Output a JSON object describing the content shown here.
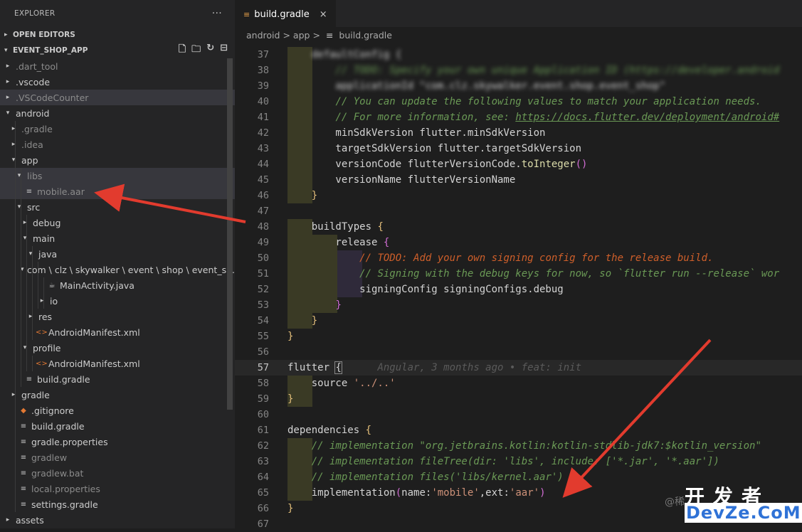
{
  "sidebar": {
    "title": "EXPLORER",
    "more": "···",
    "open_editors": "OPEN EDITORS",
    "project": "EVENT_SHOP_APP",
    "tree": [
      {
        "label": ".dart_tool",
        "depth": 1,
        "chev": "▸",
        "dim": true
      },
      {
        "label": ".vscode",
        "depth": 1,
        "chev": "▸",
        "dim": false
      },
      {
        "label": ".VSCodeCounter",
        "depth": 1,
        "chev": "▸",
        "dim": true,
        "sel": true
      },
      {
        "label": "android",
        "depth": 1,
        "chev": "▾",
        "dim": false
      },
      {
        "label": ".gradle",
        "depth": 2,
        "chev": "▸",
        "dim": true
      },
      {
        "label": ".idea",
        "depth": 2,
        "chev": "▸",
        "dim": true
      },
      {
        "label": "app",
        "depth": 2,
        "chev": "▾",
        "dim": false
      },
      {
        "label": "libs",
        "depth": 3,
        "chev": "▾",
        "dim": true,
        "sel": true
      },
      {
        "label": "mobile.aar",
        "depth": 3,
        "icon": "file-lines-icon",
        "dim": true,
        "sel": true
      },
      {
        "label": "src",
        "depth": 3,
        "chev": "▾",
        "dim": false
      },
      {
        "label": "debug",
        "depth": 4,
        "chev": "▸",
        "dim": false
      },
      {
        "label": "main",
        "depth": 4,
        "chev": "▾",
        "dim": false
      },
      {
        "label": "java",
        "depth": 5,
        "chev": "▾",
        "dim": false
      },
      {
        "label": "com \\ clz \\ skywalker \\ event \\ shop \\ event_s...",
        "depth": 6,
        "chev": "▾",
        "dim": false
      },
      {
        "label": "MainActivity.java",
        "depth": 7,
        "icon": "java-icon",
        "dim": false
      },
      {
        "label": "io",
        "depth": 7,
        "chev": "▸",
        "dim": false
      },
      {
        "label": "res",
        "depth": 5,
        "chev": "▸",
        "dim": false
      },
      {
        "label": "AndroidManifest.xml",
        "depth": 5,
        "icon": "xml-icon",
        "dim": false
      },
      {
        "label": "profile",
        "depth": 4,
        "chev": "▾",
        "dim": false
      },
      {
        "label": "AndroidManifest.xml",
        "depth": 5,
        "icon": "xml-icon",
        "dim": false
      },
      {
        "label": "build.gradle",
        "depth": 3,
        "icon": "file-lines-icon",
        "dim": false
      },
      {
        "label": "gradle",
        "depth": 2,
        "chev": "▸",
        "dim": false
      },
      {
        "label": ".gitignore",
        "depth": 2,
        "icon": "git-icon",
        "dim": false
      },
      {
        "label": "build.gradle",
        "depth": 2,
        "icon": "file-lines-icon",
        "dim": false
      },
      {
        "label": "gradle.properties",
        "depth": 2,
        "icon": "file-lines-icon",
        "dim": false
      },
      {
        "label": "gradlew",
        "depth": 2,
        "icon": "file-lines-icon",
        "dim": true
      },
      {
        "label": "gradlew.bat",
        "depth": 2,
        "icon": "file-lines-icon",
        "dim": true
      },
      {
        "label": "local.properties",
        "depth": 2,
        "icon": "file-lines-icon",
        "dim": true
      },
      {
        "label": "settings.gradle",
        "depth": 2,
        "icon": "file-lines-icon",
        "dim": false
      },
      {
        "label": "assets",
        "depth": 1,
        "chev": "▸",
        "dim": false
      }
    ]
  },
  "editor": {
    "tab_label": "build.gradle",
    "tab_close": "×",
    "breadcrumb": [
      "android",
      "app",
      "build.gradle"
    ],
    "breadcrumb_sep": ">",
    "lines": [
      {
        "n": "37",
        "html": "<span class='blur'>    defaultConfig {</span>"
      },
      {
        "n": "38",
        "html": "<span class='blur cm'>        // TODO: Specify your own unique Application ID (https://developer.android</span>"
      },
      {
        "n": "39",
        "html": "<span class='blur'>        applicationId \"com.clz.skywalker.event.shop.event_shop\"</span>"
      },
      {
        "n": "40",
        "html": "        <span class='cm'>// You can update the following values to match your application needs.</span>"
      },
      {
        "n": "41",
        "html": "        <span class='cm'>// For more information, see: <span class='link'>https://docs.flutter.dev/deployment/android#</span></span>"
      },
      {
        "n": "42",
        "html": "        minSdkVersion flutter.minSdkVersion"
      },
      {
        "n": "43",
        "html": "        targetSdkVersion flutter.targetSdkVersion"
      },
      {
        "n": "44",
        "html": "        versionCode flutterVersionCode.<span class='kw'>toInteger</span><span class='br2'>()</span>"
      },
      {
        "n": "45",
        "html": "        versionName flutterVersionName"
      },
      {
        "n": "46",
        "html": "    <span class='br'>}</span>"
      },
      {
        "n": "47",
        "html": ""
      },
      {
        "n": "48",
        "html": "    buildTypes <span class='br'>{</span>"
      },
      {
        "n": "49",
        "html": "        release <span class='br2'>{</span>"
      },
      {
        "n": "50",
        "html": "            <span class='todo'>// TODO: Add your own signing config for the release build.</span>"
      },
      {
        "n": "51",
        "html": "            <span class='cm'>// Signing with the debug keys for now, so `flutter run --release` wor</span>"
      },
      {
        "n": "52",
        "html": "            signingConfig signingConfigs.debug"
      },
      {
        "n": "53",
        "html": "        <span class='br2'>}</span>"
      },
      {
        "n": "54",
        "html": "    <span class='br'>}</span>"
      },
      {
        "n": "55",
        "html": "<span class='br'>}</span>"
      },
      {
        "n": "56",
        "html": ""
      },
      {
        "n": "57",
        "html": "flutter <span style='outline:1px solid #888;'>{</span>      <span class='lense'>Angular, 3 months ago • feat: init</span>",
        "cur": true
      },
      {
        "n": "58",
        "html": "    source <span class='st'>'../..'</span>"
      },
      {
        "n": "59",
        "html": "<span class='br'>}</span>"
      },
      {
        "n": "60",
        "html": ""
      },
      {
        "n": "61",
        "html": "dependencies <span class='br'>{</span>"
      },
      {
        "n": "62",
        "html": "    <span class='cm'>// implementation \"org.jetbrains.kotlin:kotlin-stdlib-jdk7:$kotlin_version\"</span>"
      },
      {
        "n": "63",
        "html": "    <span class='cm'>// implementation fileTree(dir: 'libs', include: ['*.jar', '*.aar'])</span>"
      },
      {
        "n": "64",
        "html": "    <span class='cm'>// implementation files('libs/kernel.aar')</span>"
      },
      {
        "n": "65",
        "html": "    implementation<span class='br2'>(</span>name:<span class='st'>'mobile'</span>,ext:<span class='st'>'aar'</span><span class='br2'>)</span>"
      },
      {
        "n": "66",
        "html": "<span class='br'>}</span>"
      },
      {
        "n": "67",
        "html": ""
      }
    ]
  },
  "watermark": {
    "line1": "开发者",
    "line2": "DevZe.CoM",
    "prefix": "@稀"
  }
}
